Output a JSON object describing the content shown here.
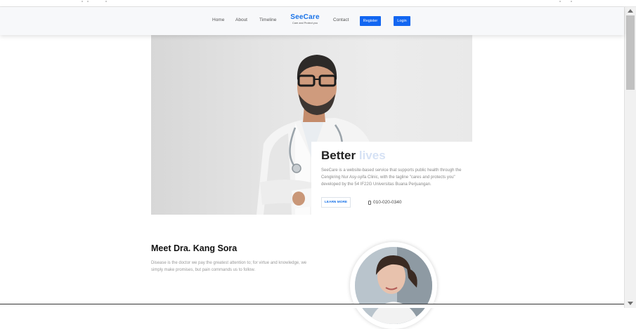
{
  "nav": {
    "home": "Home",
    "about": "About",
    "timeline": "Timeline",
    "brand_name": "SeeCare",
    "brand_tagline": "Care and Protect you",
    "contact": "Contact",
    "register": "Register",
    "login": "Login"
  },
  "hero": {
    "title_main": "Better",
    "title_faded": "lives",
    "description": "SeeCare is a website-based service that supports public health through the Cengkring Nur Asy-syifa Clinic, with the tagline \"cares and protects you\" developed by the 54 IF22G Universitas Buana Perjuangan.",
    "learn_more": "LEARN MORE",
    "phone": "010-020-0340"
  },
  "meet": {
    "title": "Meet Dra. Kang Sora",
    "text": "Disease is the doctor we pay the greatest attention to; for virtue and knowledge, we simply make promises, but pain commands us to follow."
  },
  "colors": {
    "accent": "#1266f1",
    "brand": "#1a73e8"
  }
}
